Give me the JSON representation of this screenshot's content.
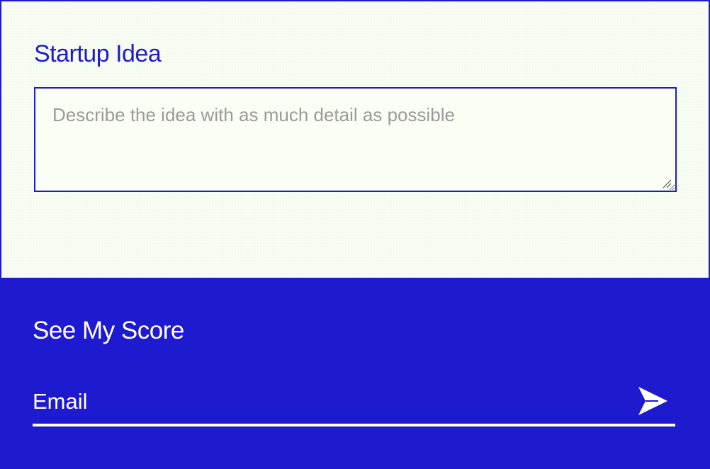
{
  "idea_form": {
    "title": "Startup Idea",
    "textarea": {
      "value": "",
      "placeholder": "Describe the idea with as much detail as possible"
    }
  },
  "score_section": {
    "title": "See My Score",
    "email_input": {
      "value": "",
      "placeholder": "Email"
    },
    "submit_icon": "send-arrow-icon"
  },
  "colors": {
    "brand_blue": "#1e1ad0",
    "panel_background": "#f8fdf4",
    "text_on_blue": "#ffffff",
    "placeholder_gray": "#9a9a9a"
  }
}
